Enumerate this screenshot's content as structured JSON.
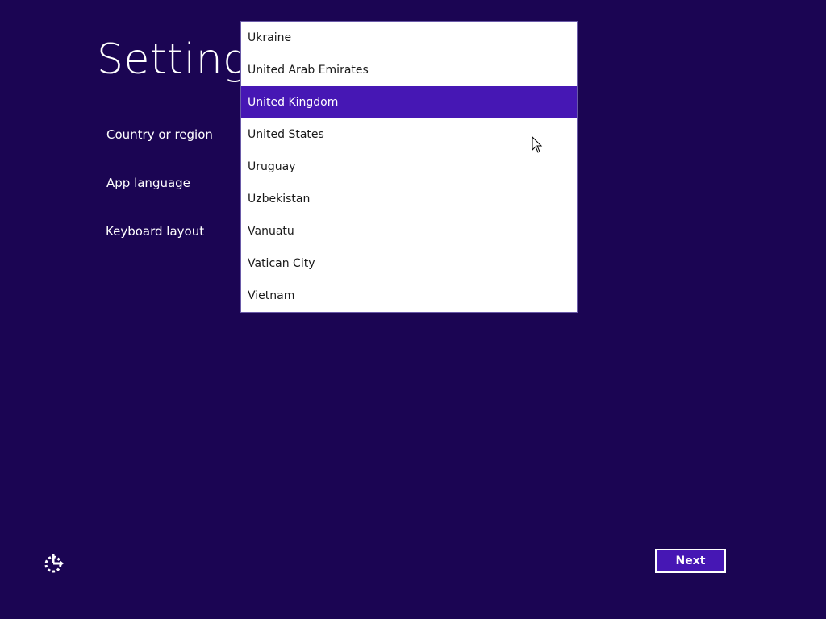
{
  "page": {
    "title": "Settings"
  },
  "fields": {
    "country_label": "Country or region",
    "app_language_label": "App language",
    "keyboard_label": "Keyboard layout"
  },
  "country_dropdown": {
    "items": [
      "Ukraine",
      "United Arab Emirates",
      "United Kingdom",
      "United States",
      "Uruguay",
      "Uzbekistan",
      "Vanuatu",
      "Vatican City",
      "Vietnam"
    ],
    "selected": "United Kingdom"
  },
  "footer": {
    "next_label": "Next",
    "ease_of_access_icon": "ease-of-access-icon"
  },
  "colors": {
    "background": "#1b0553",
    "accent": "#4617b4",
    "text": "#ffffff"
  }
}
